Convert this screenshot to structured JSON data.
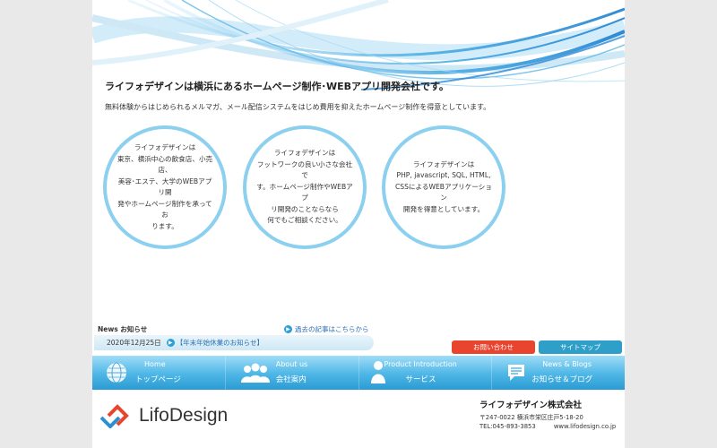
{
  "hero": {
    "headline": "ライフォデザインは横浜にあるホームページ制作･WEBアプリ開発会社です。",
    "subline": "無料体験からはじめられるメルマガ、メール配信システムをはじめ費用を抑えたホームページ制作を得意としています。"
  },
  "circles": [
    {
      "text": "ライフォデザインは\n東京、横浜中心の飲食店、小売店、\n美容･エステ、大学のWEBアプリ開\n発やホームページ制作を承ってお\nります。"
    },
    {
      "text": "ライフォデザインは\nフットワークの良い小さな会社で\nす。ホームページ制作やWEBアプ\nリ開発のことならなら\n何でもご相談ください。"
    },
    {
      "text": "ライフォデザインは\nPHP, javascript, SQL, HTML,\nCSSによるWEBアプリケーション\n開発を得意としています。"
    }
  ],
  "news": {
    "label": "News お知らせ",
    "more": "過去の記事はこちらから",
    "date": "2020年12月25日",
    "title": "【年末年始休業のお知らせ】"
  },
  "buttons": {
    "contact": "お問い合わせ",
    "sitemap": "サイトマップ"
  },
  "nav": [
    {
      "en": "Home",
      "ja": "トップページ",
      "icon": "globe-icon"
    },
    {
      "en": "About us",
      "ja": "会社案内",
      "icon": "people-icon"
    },
    {
      "en": "Product Introduction",
      "ja": "サービス",
      "icon": "person-icon"
    },
    {
      "en": "News & Blogs",
      "ja": "お知らせ＆ブログ",
      "icon": "chat-icon"
    }
  ],
  "footer": {
    "logo": "LifoDesign",
    "company": "ライフォデザイン株式会社",
    "address": "〒247-0022 横浜市栄区庄戸5-18-20",
    "tel": "TEL:045-893-3853",
    "url": "www.lifodesign.co.jp"
  },
  "colors": {
    "accent": "#2d9fc8",
    "contact_button": "#e8442e",
    "circle_border": "#8cd0ef"
  }
}
